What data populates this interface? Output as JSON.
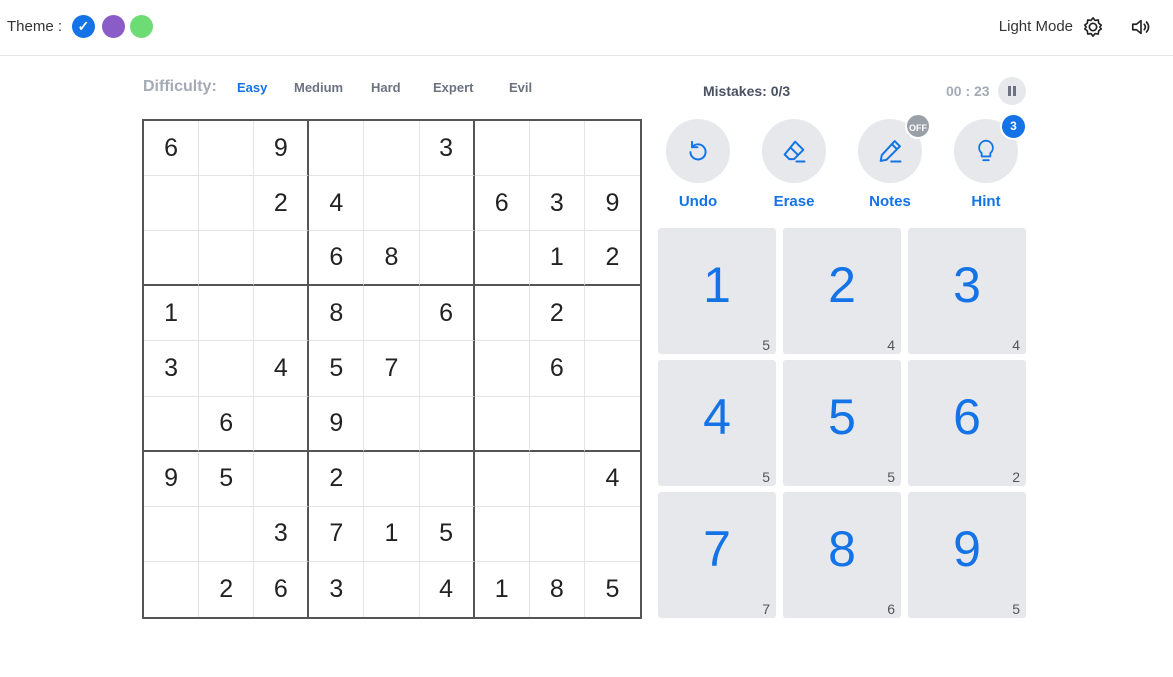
{
  "header": {
    "theme_label": "Theme :",
    "theme_colors": [
      "#1473e6",
      "#8a5cc7",
      "#6ddc74"
    ],
    "selected_theme_check": "✓",
    "mode_label": "Light Mode",
    "mode_icon": "brightness-gear-icon",
    "sound_icon": "speaker-volume-icon"
  },
  "difficulty": {
    "title": "Difficulty:",
    "levels": [
      "Easy",
      "Medium",
      "Hard",
      "Expert",
      "Evil"
    ],
    "selected": "Easy"
  },
  "status": {
    "mistakes": "Mistakes: 0/3",
    "timer": "00 : 23"
  },
  "board": [
    [
      "6",
      "",
      "9",
      "",
      "",
      "3",
      "",
      "",
      ""
    ],
    [
      "",
      "",
      "2",
      "4",
      "",
      "",
      "6",
      "3",
      "9"
    ],
    [
      "",
      "",
      "",
      "6",
      "8",
      "",
      "",
      "1",
      "2"
    ],
    [
      "1",
      "",
      "",
      "8",
      "",
      "6",
      "",
      "2",
      ""
    ],
    [
      "3",
      "",
      "4",
      "5",
      "7",
      "",
      "",
      "6",
      ""
    ],
    [
      "",
      "6",
      "",
      "9",
      "",
      "",
      "",
      "",
      ""
    ],
    [
      "9",
      "5",
      "",
      "2",
      "",
      "",
      "",
      "",
      "4"
    ],
    [
      "",
      "",
      "3",
      "7",
      "1",
      "5",
      "",
      "",
      ""
    ],
    [
      "",
      "2",
      "6",
      "3",
      "",
      "4",
      "1",
      "8",
      "5"
    ]
  ],
  "actions": {
    "undo": "Undo",
    "erase": "Erase",
    "notes": "Notes",
    "notes_state": "OFF",
    "hint": "Hint",
    "hint_count": "3"
  },
  "numpad": [
    {
      "digit": "1",
      "remaining": "5"
    },
    {
      "digit": "2",
      "remaining": "4"
    },
    {
      "digit": "3",
      "remaining": "4"
    },
    {
      "digit": "4",
      "remaining": "5"
    },
    {
      "digit": "5",
      "remaining": "5"
    },
    {
      "digit": "6",
      "remaining": "2"
    },
    {
      "digit": "7",
      "remaining": "7"
    },
    {
      "digit": "8",
      "remaining": "6"
    },
    {
      "digit": "9",
      "remaining": "5"
    }
  ]
}
